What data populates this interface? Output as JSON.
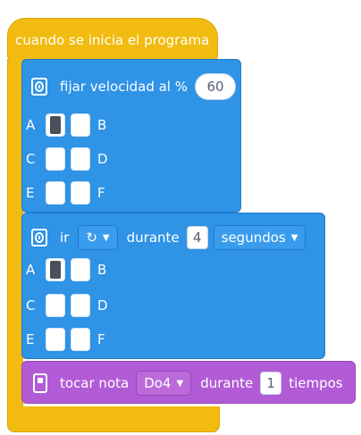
{
  "hat": {
    "label": "cuando se inicia el programa"
  },
  "block_speed": {
    "label": "fijar velocidad al %",
    "value": "60",
    "ports": [
      {
        "left": "A",
        "right": "B",
        "fill": true
      },
      {
        "left": "C",
        "right": "D",
        "fill": false
      },
      {
        "left": "E",
        "right": "F",
        "fill": false
      }
    ]
  },
  "block_go": {
    "label_ir": "ir",
    "dir_icon": "rotate-cw-icon",
    "label_durante": "durante",
    "value": "4",
    "unit": "segundos",
    "ports": [
      {
        "left": "A",
        "right": "B",
        "fill": true
      },
      {
        "left": "C",
        "right": "D",
        "fill": false
      },
      {
        "left": "E",
        "right": "F",
        "fill": false
      }
    ]
  },
  "block_note": {
    "label": "tocar nota",
    "note": "Do4",
    "label_durante": "durante",
    "value": "1",
    "unit": "tiempos"
  },
  "colors": {
    "event": "#f2bb0f",
    "motor": "#2f93e6",
    "sound": "#b25bd6"
  }
}
